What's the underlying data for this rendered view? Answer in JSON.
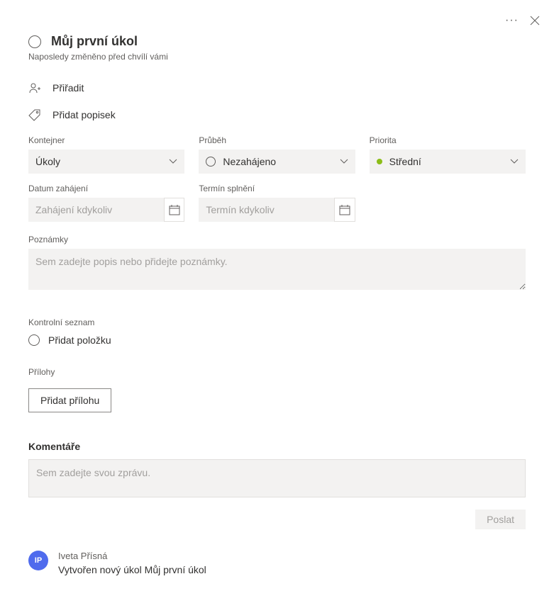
{
  "header": {
    "title": "Můj první úkol",
    "subtitle": "Naposledy změněno před chvílí vámi"
  },
  "actions": {
    "assign": "Přiřadit",
    "add_label": "Přidat popisek"
  },
  "fields": {
    "container": {
      "label": "Kontejner",
      "value": "Úkoly"
    },
    "progress": {
      "label": "Průběh",
      "value": "Nezahájeno"
    },
    "priority": {
      "label": "Priorita",
      "value": "Střední"
    },
    "start_date": {
      "label": "Datum zahájení",
      "placeholder": "Zahájení kdykoliv"
    },
    "due_date": {
      "label": "Termín splnění",
      "placeholder": "Termín kdykoliv"
    }
  },
  "notes": {
    "label": "Poznámky",
    "placeholder": "Sem zadejte popis nebo přidejte poznámky."
  },
  "checklist": {
    "label": "Kontrolní seznam",
    "add_item": "Přidat položku"
  },
  "attachments": {
    "label": "Přílohy",
    "button": "Přidat přílohu"
  },
  "comments": {
    "label": "Komentáře",
    "placeholder": "Sem zadejte svou zprávu.",
    "send": "Poslat"
  },
  "activity": {
    "avatar_initials": "IP",
    "name": "Iveta Přísná",
    "text": "Vytvořen nový úkol Můj první úkol"
  }
}
